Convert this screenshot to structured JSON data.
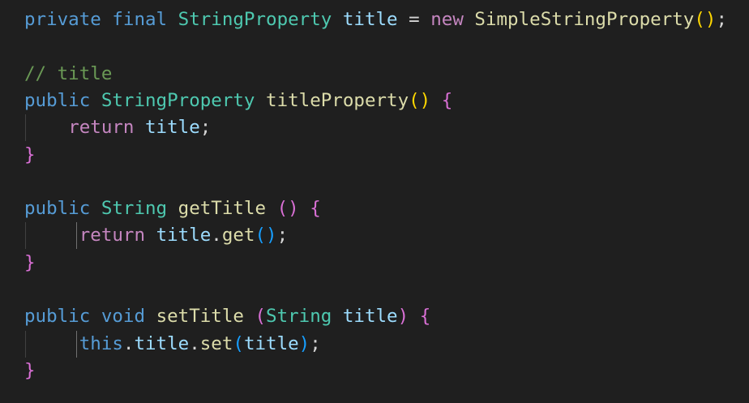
{
  "editor": {
    "theme": {
      "background": "#1f1f1f",
      "keyword": "#569cd6",
      "control": "#c586c0",
      "type": "#4ec9b0",
      "function": "#dcdcaa",
      "variable": "#9cdcfe",
      "comment": "#6a9955",
      "punctuation": "#d4d4d4",
      "bracket_gold": "#ffd700",
      "bracket_pink": "#da70d6",
      "bracket_blue": "#179fff"
    },
    "lines": [
      {
        "tokens": [
          {
            "text": "private",
            "color": "#569cd6"
          },
          {
            "text": " ",
            "color": "#d4d4d4"
          },
          {
            "text": "final",
            "color": "#569cd6"
          },
          {
            "text": " ",
            "color": "#d4d4d4"
          },
          {
            "text": "StringProperty",
            "color": "#4ec9b0"
          },
          {
            "text": " ",
            "color": "#d4d4d4"
          },
          {
            "text": "title",
            "color": "#9cdcfe"
          },
          {
            "text": " = ",
            "color": "#d4d4d4"
          },
          {
            "text": "new",
            "color": "#c586c0"
          },
          {
            "text": " ",
            "color": "#d4d4d4"
          },
          {
            "text": "SimpleStringProperty",
            "color": "#dcdcaa"
          },
          {
            "text": "()",
            "color": "#ffd700"
          },
          {
            "text": ";",
            "color": "#d4d4d4"
          }
        ]
      },
      {
        "tokens": []
      },
      {
        "tokens": [
          {
            "text": "// title",
            "color": "#6a9955"
          }
        ]
      },
      {
        "tokens": [
          {
            "text": "public",
            "color": "#569cd6"
          },
          {
            "text": " ",
            "color": "#d4d4d4"
          },
          {
            "text": "StringProperty",
            "color": "#4ec9b0"
          },
          {
            "text": " ",
            "color": "#d4d4d4"
          },
          {
            "text": "titleProperty",
            "color": "#dcdcaa"
          },
          {
            "text": "()",
            "color": "#ffd700"
          },
          {
            "text": " ",
            "color": "#d4d4d4"
          },
          {
            "text": "{",
            "color": "#da70d6"
          }
        ]
      },
      {
        "tokens": [
          {
            "text": "    ",
            "color": "#d4d4d4"
          },
          {
            "text": "return",
            "color": "#c586c0"
          },
          {
            "text": " ",
            "color": "#d4d4d4"
          },
          {
            "text": "title",
            "color": "#9cdcfe"
          },
          {
            "text": ";",
            "color": "#d4d4d4"
          }
        ]
      },
      {
        "tokens": [
          {
            "text": "}",
            "color": "#da70d6"
          }
        ]
      },
      {
        "tokens": []
      },
      {
        "tokens": [
          {
            "text": "public",
            "color": "#569cd6"
          },
          {
            "text": " ",
            "color": "#d4d4d4"
          },
          {
            "text": "String",
            "color": "#4ec9b0"
          },
          {
            "text": " ",
            "color": "#d4d4d4"
          },
          {
            "text": "getTitle",
            "color": "#dcdcaa"
          },
          {
            "text": " ",
            "color": "#d4d4d4"
          },
          {
            "text": "()",
            "color": "#da70d6"
          },
          {
            "text": " ",
            "color": "#d4d4d4"
          },
          {
            "text": "{",
            "color": "#da70d6"
          }
        ]
      },
      {
        "tokens": [
          {
            "text": "     ",
            "color": "#d4d4d4"
          },
          {
            "text": "return",
            "color": "#c586c0"
          },
          {
            "text": " ",
            "color": "#d4d4d4"
          },
          {
            "text": "title",
            "color": "#9cdcfe"
          },
          {
            "text": ".",
            "color": "#d4d4d4"
          },
          {
            "text": "get",
            "color": "#dcdcaa"
          },
          {
            "text": "()",
            "color": "#179fff"
          },
          {
            "text": ";",
            "color": "#d4d4d4"
          }
        ]
      },
      {
        "tokens": [
          {
            "text": "}",
            "color": "#da70d6"
          }
        ]
      },
      {
        "tokens": []
      },
      {
        "tokens": [
          {
            "text": "public",
            "color": "#569cd6"
          },
          {
            "text": " ",
            "color": "#d4d4d4"
          },
          {
            "text": "void",
            "color": "#569cd6"
          },
          {
            "text": " ",
            "color": "#d4d4d4"
          },
          {
            "text": "setTitle",
            "color": "#dcdcaa"
          },
          {
            "text": " ",
            "color": "#d4d4d4"
          },
          {
            "text": "(",
            "color": "#da70d6"
          },
          {
            "text": "String",
            "color": "#4ec9b0"
          },
          {
            "text": " ",
            "color": "#d4d4d4"
          },
          {
            "text": "title",
            "color": "#9cdcfe"
          },
          {
            "text": ")",
            "color": "#da70d6"
          },
          {
            "text": " ",
            "color": "#d4d4d4"
          },
          {
            "text": "{",
            "color": "#da70d6"
          }
        ]
      },
      {
        "tokens": [
          {
            "text": "     ",
            "color": "#d4d4d4"
          },
          {
            "text": "this",
            "color": "#569cd6"
          },
          {
            "text": ".",
            "color": "#d4d4d4"
          },
          {
            "text": "title",
            "color": "#9cdcfe"
          },
          {
            "text": ".",
            "color": "#d4d4d4"
          },
          {
            "text": "set",
            "color": "#dcdcaa"
          },
          {
            "text": "(",
            "color": "#179fff"
          },
          {
            "text": "title",
            "color": "#9cdcfe"
          },
          {
            "text": ")",
            "color": "#179fff"
          },
          {
            "text": ";",
            "color": "#d4d4d4"
          }
        ]
      },
      {
        "tokens": [
          {
            "text": "}",
            "color": "#da70d6"
          }
        ]
      }
    ],
    "indent_guides": [
      {
        "line": 4,
        "active": false
      },
      {
        "line": 8,
        "active": false
      },
      {
        "line": 12,
        "active": false
      }
    ],
    "active_guides": [
      {
        "line": 8
      },
      {
        "line": 12
      }
    ]
  }
}
